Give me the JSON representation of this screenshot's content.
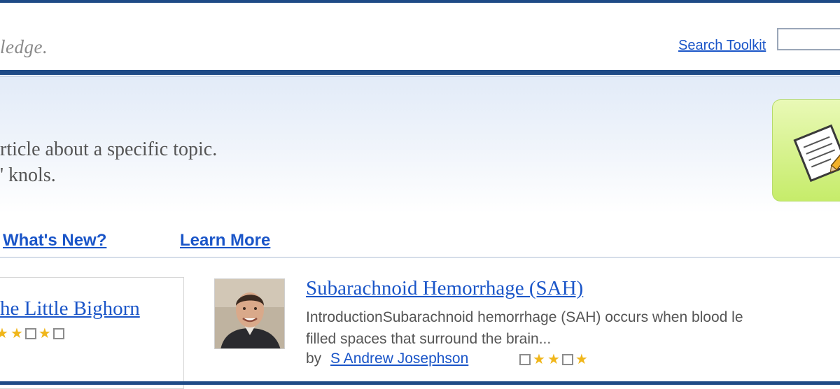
{
  "header": {
    "tagline": "ledge.",
    "search_link": "Search Toolkit",
    "search_value": ""
  },
  "banner": {
    "line1": "rticle about a specific topic.",
    "line2": "' knols."
  },
  "nav": {
    "whats_new": "What's New?",
    "learn_more": "Learn More"
  },
  "featured_left": {
    "title": "he Little Bighorn",
    "rating_pattern": [
      "star",
      "star",
      "empty",
      "star",
      "empty"
    ]
  },
  "featured_knol": {
    "title": "Subarachnoid Hemorrhage (SAH)",
    "snippet_line1": "IntroductionSubarachnoid hemorrhage (SAH) occurs when blood le",
    "snippet_line2": "filled spaces that surround the brain...",
    "by_label": "by",
    "author": "S Andrew Josephson",
    "rating_pattern": [
      "empty",
      "star",
      "star",
      "empty",
      "star"
    ]
  },
  "colors": {
    "brand_navy": "#1e4a86",
    "link_blue": "#1a55c8",
    "star_gold": "#f0b61a",
    "badge_green": "#c6ec6a"
  },
  "icons": {
    "write_badge": "write-knol-notepad-pencil-icon",
    "thumbnail": "author-photo"
  }
}
